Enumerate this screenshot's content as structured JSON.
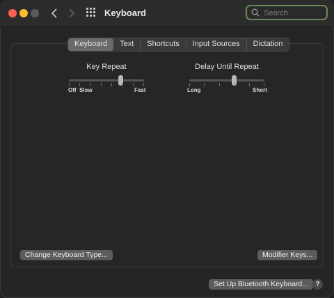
{
  "window": {
    "title": "Keyboard"
  },
  "search": {
    "placeholder": "Search",
    "value": ""
  },
  "tabs": [
    {
      "label": "Keyboard",
      "selected": true
    },
    {
      "label": "Text",
      "selected": false
    },
    {
      "label": "Shortcuts",
      "selected": false
    },
    {
      "label": "Input Sources",
      "selected": false
    },
    {
      "label": "Dictation",
      "selected": false
    }
  ],
  "key_repeat": {
    "label": "Key Repeat",
    "left_labels": [
      "Off",
      "Slow"
    ],
    "right_label": "Fast",
    "level": 0.7
  },
  "delay_until_repeat": {
    "label": "Delay Until Repeat",
    "left_label": "Long",
    "right_label": "Short",
    "level": 0.6
  },
  "buttons": {
    "change_keyboard_type": "Change Keyboard Type...",
    "modifier_keys": "Modifier Keys...",
    "setup_bluetooth": "Set Up Bluetooth Keyboard...",
    "help": "?"
  },
  "colors": {
    "search_focus_ring": "#6a8a5a",
    "close": "#ff5f57",
    "minimize": "#febc2e"
  }
}
